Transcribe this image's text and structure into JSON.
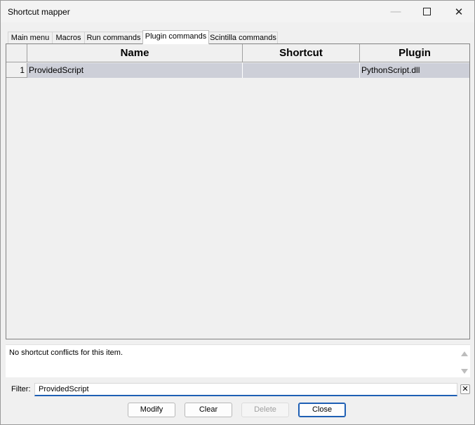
{
  "window": {
    "title": "Shortcut mapper",
    "minimize_glyph": "—",
    "close_glyph": "✕"
  },
  "tabs": [
    {
      "label": "Main menu",
      "active": false
    },
    {
      "label": "Macros",
      "active": false
    },
    {
      "label": "Run commands",
      "active": false
    },
    {
      "label": "Plugin commands",
      "active": true
    },
    {
      "label": "Scintilla commands",
      "active": false
    }
  ],
  "grid": {
    "columns": [
      "Name",
      "Shortcut",
      "Plugin"
    ],
    "rows": [
      {
        "index": "1",
        "name": "ProvidedScript",
        "shortcut": "",
        "plugin": "PythonScript.dll",
        "selected": true
      }
    ]
  },
  "info": {
    "text": "No shortcut conflicts for this item."
  },
  "filter": {
    "label": "Filter:",
    "value": "ProvidedScript",
    "clear_glyph": "✕"
  },
  "buttons": {
    "modify": "Modify",
    "clear": "Clear",
    "delete": "Delete",
    "close": "Close"
  },
  "colors": {
    "selected_row": "#cdcfd8",
    "focus_accent": "#1e5fb4"
  }
}
